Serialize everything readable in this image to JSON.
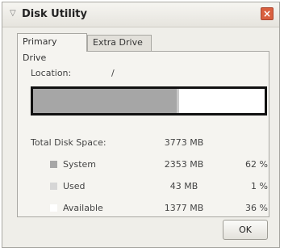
{
  "window": {
    "title": "Disk Utility",
    "close_glyph": "×"
  },
  "tabs": [
    {
      "label": "Primary Drive",
      "active": true
    },
    {
      "label": "Extra Drive",
      "active": false
    }
  ],
  "location": {
    "label": "Location:",
    "value": "/"
  },
  "usage_bar": {
    "system_fraction": 0.62,
    "used_fraction": 0.01,
    "system_color": "#a6a6a6",
    "used_color": "#c9c9c9",
    "available_color": "#ffffff"
  },
  "total": {
    "label": "Total Disk Space:",
    "size": "3773 MB"
  },
  "rows": [
    {
      "label": "System",
      "size": "2353 MB",
      "percent": "62 %",
      "color": "#a6a6a6"
    },
    {
      "label": "Used",
      "size": "43 MB",
      "percent": "1 %",
      "color": "#d6d6d6"
    },
    {
      "label": "Available",
      "size": "1377 MB",
      "percent": "36 %",
      "color": "#ffffff"
    }
  ],
  "buttons": {
    "ok_label": "OK"
  },
  "icons": {
    "title_icon": "window-menu-icon",
    "close_icon": "close-icon"
  }
}
